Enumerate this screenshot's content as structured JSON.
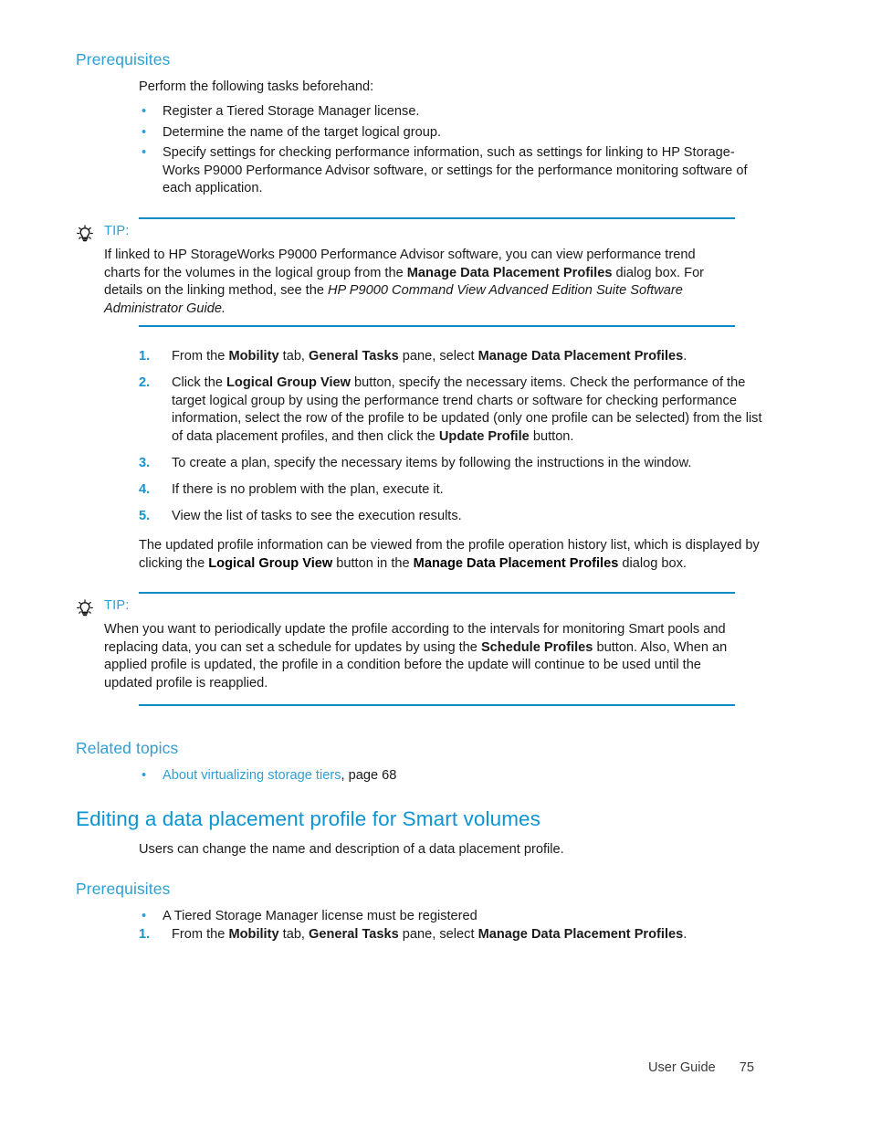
{
  "page": {
    "footer_label": "User Guide",
    "footer_page_number": "75"
  },
  "colors": {
    "heading_blue": "#2e9fd4",
    "title_blue": "#0c94d3",
    "rule_blue": "#0c8bc4",
    "body_black": "#1a1a1a"
  },
  "section_one": {
    "heading": "Prerequisites",
    "intro": "Perform the following tasks beforehand:",
    "bullets": [
      "Register a Tiered Storage Manager license.",
      "Determine the name of the target logical group.",
      "Specify settings for checking performance information, such as settings for linking to HP Storage-Works P9000 Performance Advisor software, or settings for the performance monitoring software of each application."
    ],
    "tip_one": {
      "icon": "lightbulb-icon",
      "label": "TIP:",
      "line1_a": "If linked to HP StorageWorks P9000 Performance Advisor software, you can view performance trend",
      "line2_a": "charts for the volumes in the logical group from the ",
      "line2_bold": "Manage Data Placement Profiles",
      "line2_b": " dialog box.",
      "line3_a": "For details on the linking method, see the ",
      "line3_italic": "HP P9000 Command View Advanced Edition Suite Software",
      "line4_italic": "Administrator Guide."
    },
    "steps": [
      {
        "number": "1.",
        "parts": [
          {
            "text": "From the ",
            "style": "normal"
          },
          {
            "text": "Mobility",
            "style": "bold"
          },
          {
            "text": " tab, ",
            "style": "normal"
          },
          {
            "text": "General Tasks",
            "style": "bold"
          },
          {
            "text": " pane, select ",
            "style": "normal"
          },
          {
            "text": "Manage Data Placement Profiles",
            "style": "bold"
          },
          {
            "text": ".",
            "style": "normal"
          }
        ]
      },
      {
        "number": "2.",
        "parts": [
          {
            "text": "Click the ",
            "style": "normal"
          },
          {
            "text": "Logical Group View",
            "style": "bold"
          },
          {
            "text": " button, specify the necessary items. Check the performance of the target logical group by using the performance trend charts or software for checking performance information, select the row of the profile to be updated (only one profile can be selected) from the list of data placement profiles, and then click the ",
            "style": "normal"
          },
          {
            "text": "Update Profile",
            "style": "bold"
          },
          {
            "text": " button.",
            "style": "normal"
          }
        ]
      },
      {
        "number": "3.",
        "parts": [
          {
            "text": "To create a plan, specify the necessary items by following the instructions in the window.",
            "style": "normal"
          }
        ]
      },
      {
        "number": "4.",
        "parts": [
          {
            "text": "If there is no problem with the plan, execute it.",
            "style": "normal"
          }
        ]
      },
      {
        "number": "5.",
        "parts": [
          {
            "text": "View the list of tasks to see the execution results.",
            "style": "normal"
          }
        ]
      }
    ],
    "closing_para": {
      "a": "The updated profile information can be viewed from the profile operation history list, which is displayed by clicking the ",
      "bold1": "Logical Group View",
      "b": " button in the ",
      "bold2": "Manage Data Placement Profiles",
      "c": " dialog box."
    },
    "tip_two": {
      "icon": "lightbulb-icon",
      "label": "TIP:",
      "a": "When you want to periodically update the profile according to the intervals for monitoring Smart pools and replacing data, you can set a schedule for updates by using the ",
      "bold1": "Schedule Profiles",
      "b": " button. Also, When an applied profile is updated, the profile in a condition before the update will continue to be used until the updated profile is reapplied."
    }
  },
  "related_topics": {
    "heading": "Related topics",
    "link_text": "About virtualizing storage tiers",
    "link_suffix": ", page 68"
  },
  "section_two": {
    "title": "Editing a data placement profile for Smart volumes",
    "intro": "Users can change the name and description of a data placement profile.",
    "prereq_heading": "Prerequisites",
    "bullet": "A Tiered Storage Manager license must be registered",
    "step": {
      "number": "1.",
      "parts": [
        {
          "text": "From the ",
          "style": "normal"
        },
        {
          "text": "Mobility",
          "style": "bold"
        },
        {
          "text": " tab, ",
          "style": "normal"
        },
        {
          "text": "General Tasks",
          "style": "bold"
        },
        {
          "text": " pane, select ",
          "style": "normal"
        },
        {
          "text": "Manage Data Placement Profiles",
          "style": "bold"
        },
        {
          "text": ".",
          "style": "normal"
        }
      ]
    }
  }
}
